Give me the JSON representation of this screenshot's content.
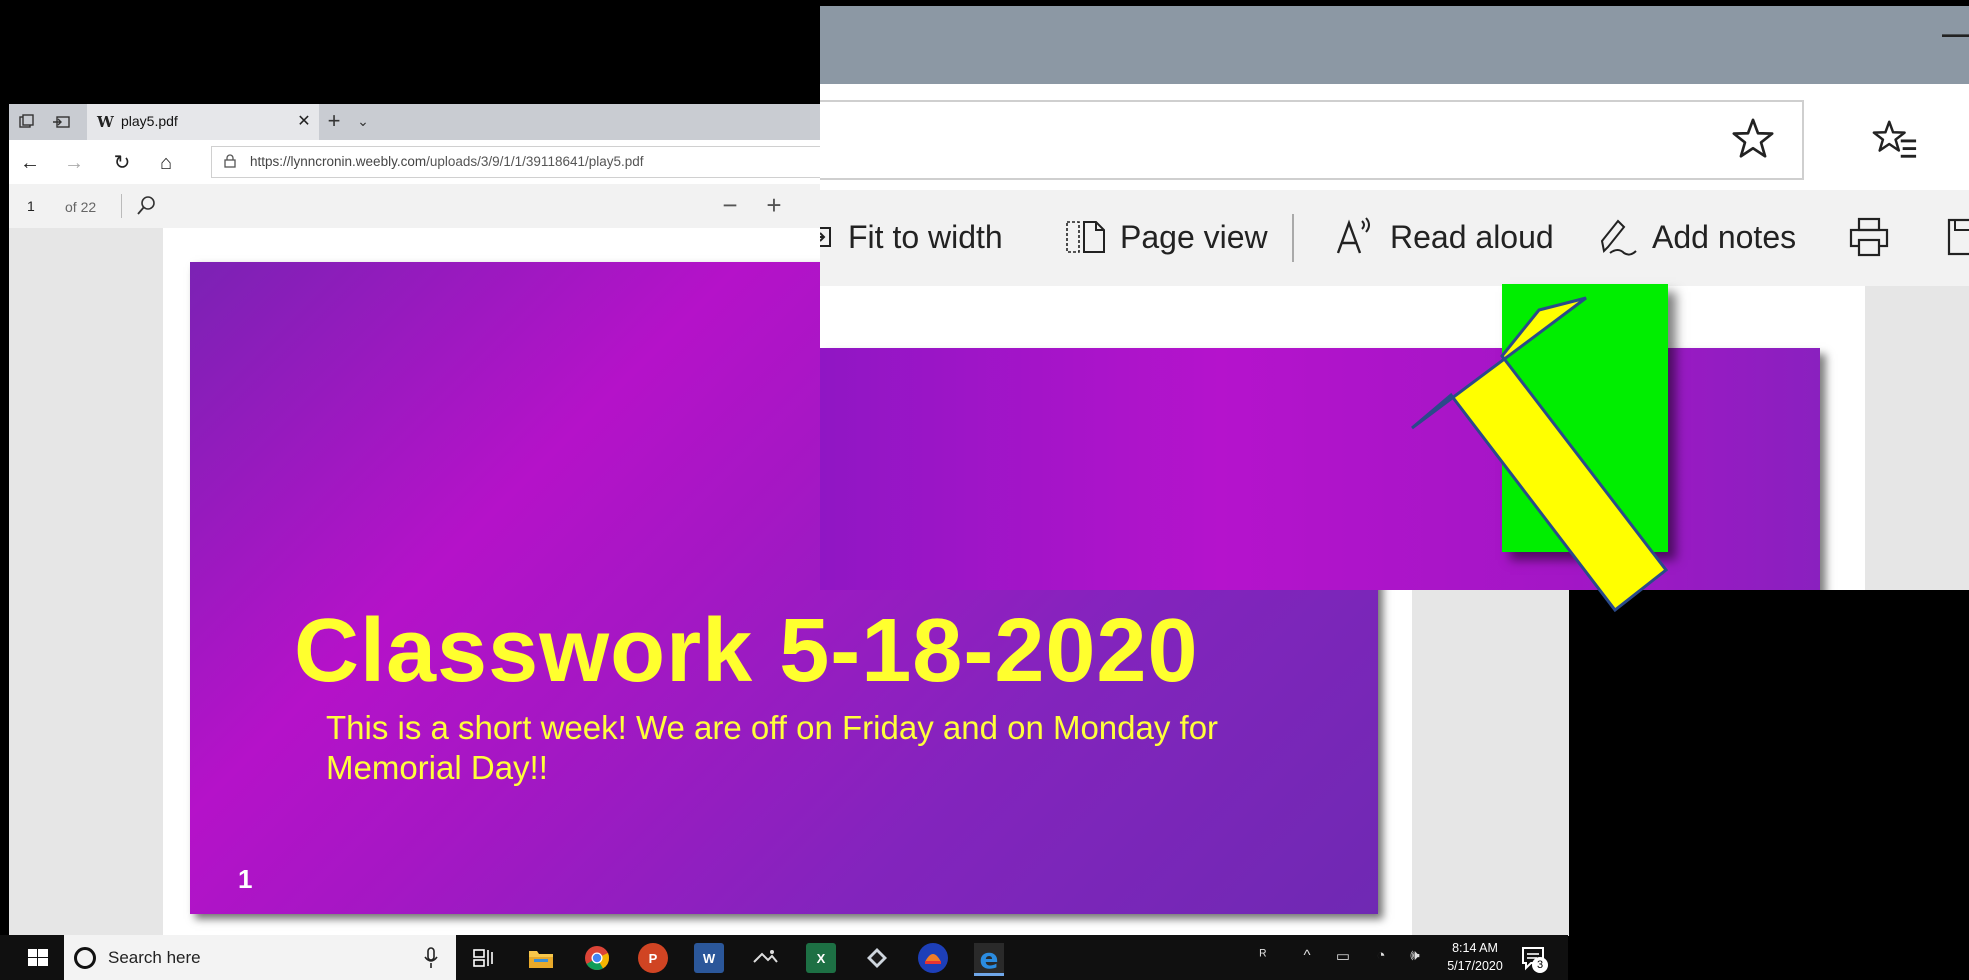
{
  "browser": {
    "tab_title": "play5.pdf",
    "url_host": "https://lynncronin.weebly.com",
    "url_path": "/uploads/3/9/1/1/39118641/play5.pdf"
  },
  "pdf_toolbar": {
    "page_number": "1",
    "page_total": "of 22"
  },
  "slide": {
    "title": "Classwork 5-18-2020",
    "subtitle": "This is a short week!  We are off on Friday and on Monday for Memorial Day!!",
    "number": "1"
  },
  "zoom_toolbar": {
    "fit_to_width": "Fit to width",
    "page_view": "Page view",
    "read_aloud": "Read aloud",
    "add_notes": "Add notes"
  },
  "taskbar": {
    "search_placeholder": "Search here",
    "time": "8:14 AM",
    "date": "5/17/2020",
    "notification_count": "3",
    "apps": [
      "task-view",
      "file-explorer",
      "chrome",
      "powerpoint",
      "word",
      "photos",
      "excel",
      "app-diamond",
      "app-blue",
      "edge"
    ]
  },
  "colors": {
    "slide_title": "#ffff2e",
    "slide_bg": "#b512c9",
    "arrow": "#ffff00",
    "green_box": "#00ee00",
    "taskbar": "#101010"
  }
}
